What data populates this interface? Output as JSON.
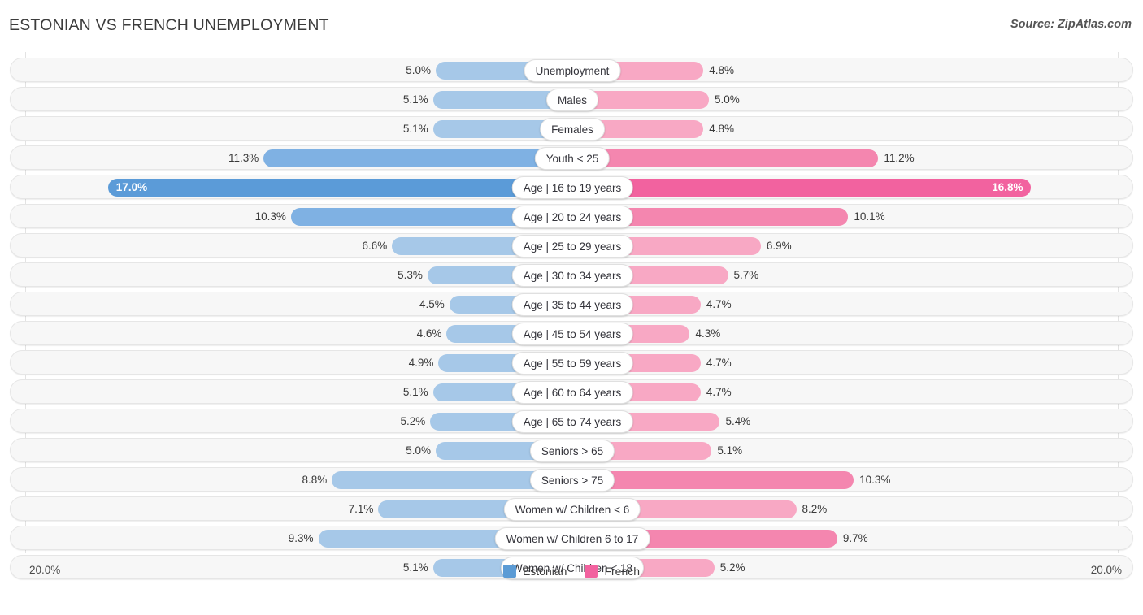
{
  "header": {
    "title": "ESTONIAN VS FRENCH UNEMPLOYMENT",
    "source": "Source: ZipAtlas.com"
  },
  "axis": {
    "left_label": "20.0%",
    "right_label": "20.0%",
    "max": 20.0
  },
  "legend": {
    "items": [
      {
        "label": "Estonian",
        "color": "#5B9BD5"
      },
      {
        "label": "French",
        "color": "#F2629F"
      }
    ]
  },
  "colors": {
    "estonian_light": "#A6C8E8",
    "estonian_mid": "#7FB1E3",
    "estonian_dark": "#5B9BD8",
    "french_light": "#F8A8C4",
    "french_mid": "#F486AF",
    "french_dark": "#F2629F",
    "row_track": "#f7f7f7",
    "row_border": "#e6e6e6",
    "gridline": "#e3e3e3"
  },
  "chart_data": {
    "type": "bar",
    "title": "ESTONIAN VS FRENCH UNEMPLOYMENT",
    "subtitle": "",
    "xlabel": "",
    "ylabel": "",
    "orientation": "horizontal-diverging",
    "xlim": [
      20.0,
      20.0
    ],
    "grid": true,
    "legend_position": "bottom-center",
    "categories": [
      "Unemployment",
      "Males",
      "Females",
      "Youth < 25",
      "Age | 16 to 19 years",
      "Age | 20 to 24 years",
      "Age | 25 to 29 years",
      "Age | 30 to 34 years",
      "Age | 35 to 44 years",
      "Age | 45 to 54 years",
      "Age | 55 to 59 years",
      "Age | 60 to 64 years",
      "Age | 65 to 74 years",
      "Seniors > 65",
      "Seniors > 75",
      "Women w/ Children < 6",
      "Women w/ Children 6 to 17",
      "Women w/ Children < 18"
    ],
    "series": [
      {
        "name": "Estonian",
        "side": "left",
        "values": [
          5.0,
          5.1,
          5.1,
          11.3,
          17.0,
          10.3,
          6.6,
          5.3,
          4.5,
          4.6,
          4.9,
          5.1,
          5.2,
          5.0,
          8.8,
          7.1,
          9.3,
          5.1
        ],
        "labels": [
          "5.0%",
          "5.1%",
          "5.1%",
          "11.3%",
          "17.0%",
          "10.3%",
          "6.6%",
          "5.3%",
          "4.5%",
          "4.6%",
          "4.9%",
          "5.1%",
          "5.2%",
          "5.0%",
          "8.8%",
          "7.1%",
          "9.3%",
          "5.1%"
        ]
      },
      {
        "name": "French",
        "side": "right",
        "values": [
          4.8,
          5.0,
          4.8,
          11.2,
          16.8,
          10.1,
          6.9,
          5.7,
          4.7,
          4.3,
          4.7,
          4.7,
          5.4,
          5.1,
          10.3,
          8.2,
          9.7,
          5.2
        ],
        "labels": [
          "4.8%",
          "5.0%",
          "4.8%",
          "11.2%",
          "16.8%",
          "10.1%",
          "6.9%",
          "5.7%",
          "4.7%",
          "4.3%",
          "4.7%",
          "4.7%",
          "5.4%",
          "5.1%",
          "10.3%",
          "8.2%",
          "9.7%",
          "5.2%"
        ]
      }
    ]
  }
}
